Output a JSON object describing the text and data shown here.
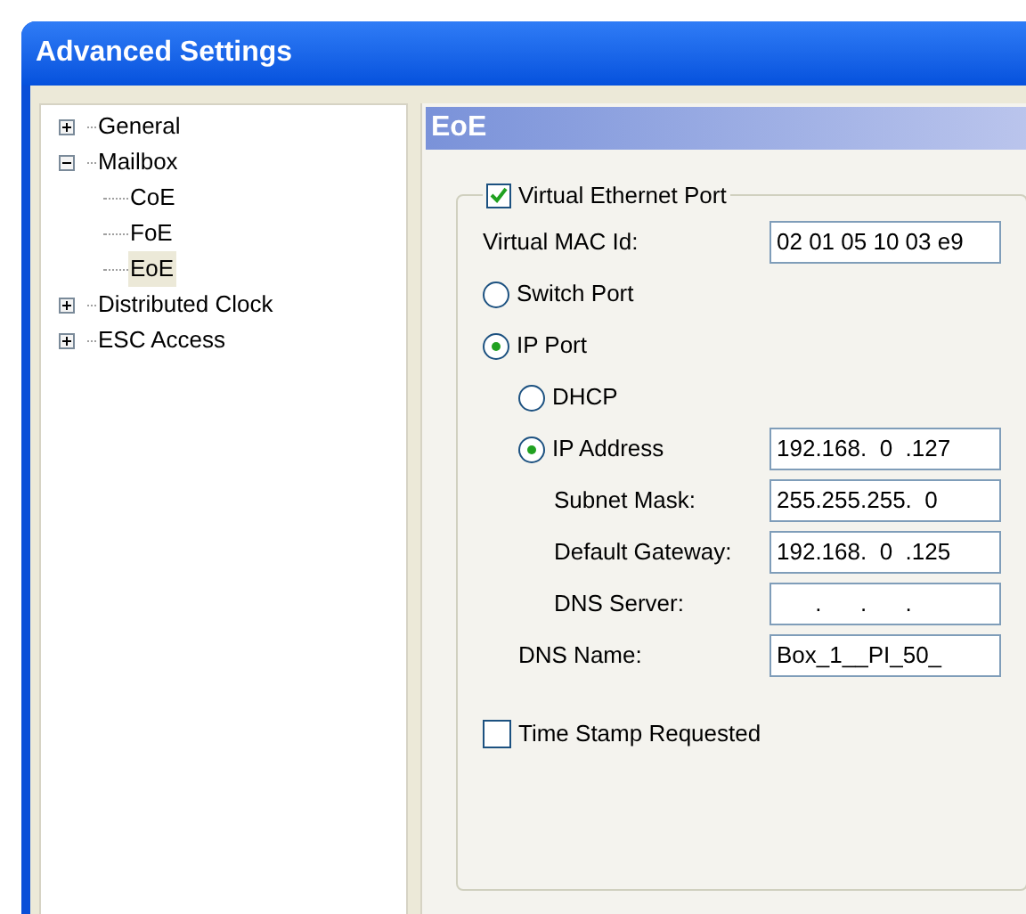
{
  "window": {
    "title": "Advanced Settings"
  },
  "tree": [
    {
      "label": "General",
      "expanded": false,
      "selected": false
    },
    {
      "label": "Mailbox",
      "expanded": true,
      "selected": false,
      "children": [
        {
          "label": "CoE",
          "selected": false
        },
        {
          "label": "FoE",
          "selected": false
        },
        {
          "label": "EoE",
          "selected": true
        }
      ]
    },
    {
      "label": "Distributed Clock",
      "expanded": false,
      "selected": false
    },
    {
      "label": "ESC Access",
      "expanded": false,
      "selected": false
    }
  ],
  "panel": {
    "title": "EoE",
    "group": {
      "label": "Virtual Ethernet Port",
      "checked": true,
      "items": [
        {
          "kind": "field",
          "label": "Virtual MAC Id:",
          "value": "02 01 05 10 03 e9"
        },
        {
          "kind": "radio",
          "label": "Switch Port",
          "selected": false
        },
        {
          "kind": "radio",
          "label": "IP Port",
          "selected": true,
          "children": [
            {
              "kind": "radio",
              "label": "DHCP",
              "selected": false
            },
            {
              "kind": "radio",
              "label": "IP Address",
              "selected": true,
              "value": "192.168.  0  .127",
              "children": [
                {
                  "kind": "field",
                  "label": "Subnet Mask:",
                  "value": "255.255.255.  0"
                },
                {
                  "kind": "field",
                  "label": "Default Gateway:",
                  "value": "192.168.  0  .125"
                },
                {
                  "kind": "field",
                  "label": "DNS Server:",
                  "value": "      .      .      ."
                }
              ]
            },
            {
              "kind": "field",
              "label": "DNS Name:",
              "value": "Box_1__PI_50_"
            }
          ]
        },
        {
          "kind": "checkbox",
          "label": "Time Stamp Requested",
          "checked": false
        }
      ]
    }
  }
}
